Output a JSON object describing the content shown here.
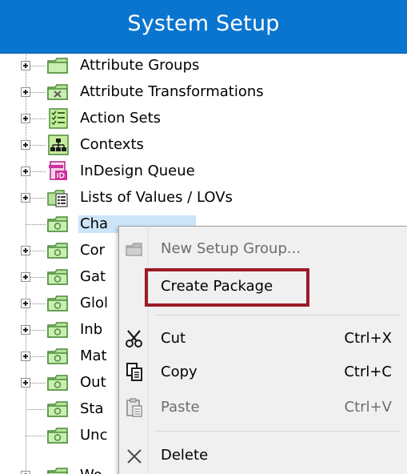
{
  "window": {
    "title": "System Setup"
  },
  "tree": {
    "items": [
      {
        "label": "Attribute Groups",
        "icon": "attribute-groups-icon",
        "expander": true
      },
      {
        "label": "Attribute Transformations",
        "icon": "attribute-transformations-icon",
        "expander": true
      },
      {
        "label": "Action Sets",
        "icon": "action-sets-icon",
        "expander": true
      },
      {
        "label": "Contexts",
        "icon": "contexts-icon",
        "expander": true
      },
      {
        "label": "InDesign Queue",
        "icon": "indesign-queue-icon",
        "expander": true
      },
      {
        "label": "Lists of Values / LOVs",
        "icon": "lists-of-values-icon",
        "expander": true
      },
      {
        "label": "Cha",
        "icon": "setup-group-icon",
        "expander": false,
        "selected": true
      },
      {
        "label": "Cor",
        "icon": "setup-group-icon",
        "expander": true
      },
      {
        "label": "Gat",
        "icon": "setup-group-icon",
        "expander": true
      },
      {
        "label": "Glol",
        "icon": "setup-group-icon",
        "expander": true
      },
      {
        "label": "Inb",
        "icon": "setup-group-icon",
        "expander": true
      },
      {
        "label": "Mat",
        "icon": "setup-group-icon",
        "expander": true
      },
      {
        "label": "Out",
        "icon": "setup-group-icon",
        "expander": true
      },
      {
        "label": "Sta",
        "icon": "setup-group-icon",
        "expander": false
      },
      {
        "label": "Unc",
        "icon": "setup-group-icon",
        "expander": false
      },
      {
        "label": "Wo",
        "icon": "setup-group-icon",
        "expander": true
      }
    ]
  },
  "context_menu": {
    "items": [
      {
        "label": "New Setup Group...",
        "shortcut": "",
        "icon": "new-setup-group-icon",
        "disabled": true
      },
      {
        "label": "Create Package",
        "shortcut": "",
        "icon": "",
        "disabled": false,
        "highlighted": true
      },
      {
        "label": "Cut",
        "shortcut": "Ctrl+X",
        "icon": "scissors-icon",
        "disabled": false
      },
      {
        "label": "Copy",
        "shortcut": "Ctrl+C",
        "icon": "copy-icon",
        "disabled": false
      },
      {
        "label": "Paste",
        "shortcut": "Ctrl+V",
        "icon": "paste-icon",
        "disabled": true
      },
      {
        "label": "Delete",
        "shortcut": "",
        "icon": "delete-x-icon",
        "disabled": false
      }
    ]
  },
  "colors": {
    "title_bar": "#0a75cf",
    "selection": "#cce4f7",
    "highlight_box": "#9a1b28",
    "menu_bg": "#f0f0f0",
    "folder_green": "#b4e39a"
  }
}
